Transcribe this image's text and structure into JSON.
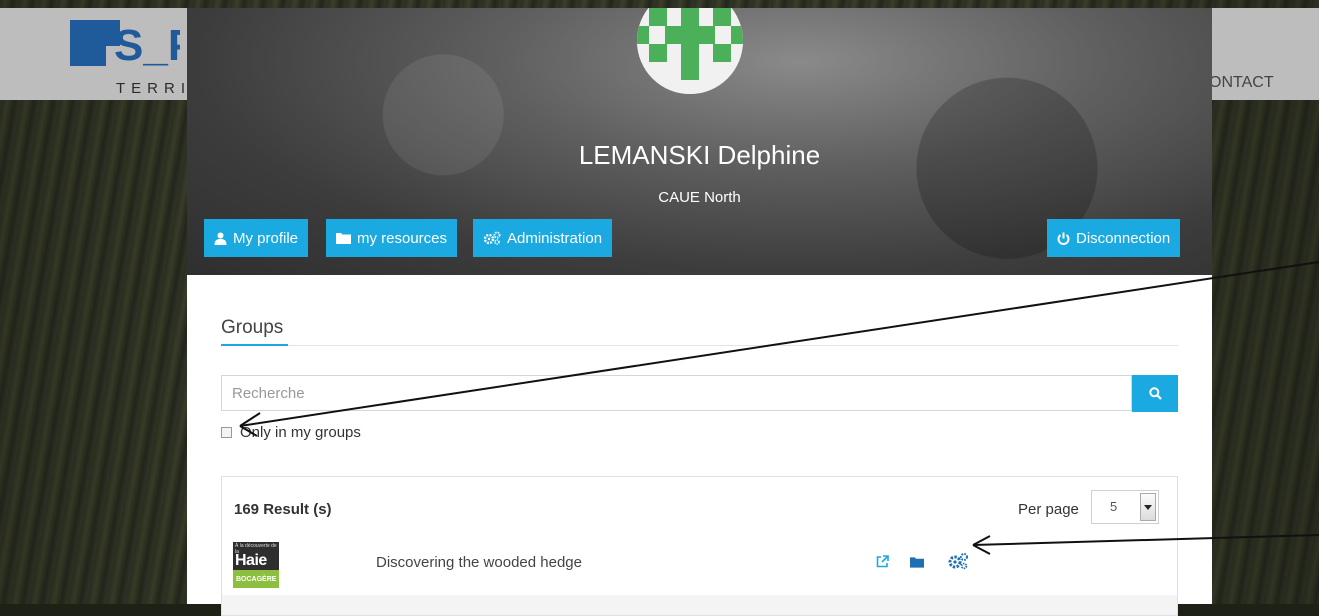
{
  "site": {
    "logo_text": "S_PA",
    "logo_subtitle": "TERRIT",
    "nav_contact": "ONTACT"
  },
  "profile": {
    "name": "LEMANSKI Delphine",
    "organization": "CAUE North",
    "buttons": {
      "my_profile": "My profile",
      "my_resources": "my resources",
      "administration": "Administration",
      "disconnection": "Disconnection"
    }
  },
  "groups": {
    "title": "Groups",
    "search_placeholder": "Recherche",
    "only_my_groups_label": "Only in my groups",
    "only_my_groups_checked": false,
    "result_count": "169 Result (s)",
    "per_page_label": "Per page",
    "per_page_value": "5",
    "items": [
      {
        "title": "Discovering the wooded hedge",
        "thumbnail": {
          "top_text": "À la découverte de la",
          "title_text": "Haie",
          "bottom_text": "BOCAGÈRE"
        }
      }
    ]
  },
  "colors": {
    "accent": "#1ba9e1",
    "avatar_pattern": "#4caf5a",
    "thumbnail_band": "#8cbf3f"
  },
  "icons": {
    "search": "search-icon",
    "checkbox": "checkbox-icon",
    "external_link": "external-link-icon",
    "folder": "folder-icon",
    "settings": "gears-icon",
    "user": "user-icon",
    "power": "power-icon"
  }
}
